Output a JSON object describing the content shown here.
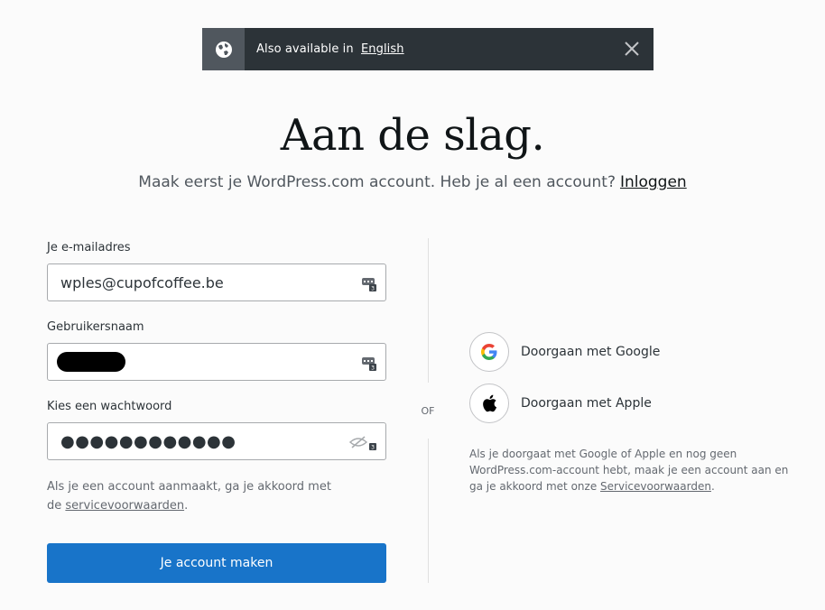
{
  "banner": {
    "text": "Also available in",
    "link": "English"
  },
  "header": {
    "title": "Aan de slag.",
    "subtitle": "Maak eerst je WordPress.com account. Heb je al een account?",
    "login_link": "Inloggen"
  },
  "form": {
    "email_label": "Je e-mailadres",
    "email_value": "wples@cupofcoffee.be",
    "username_label": "Gebruikersnaam",
    "password_label": "Kies een wachtwoord",
    "password_value": "●●●●●●●●●●●●",
    "terms_text": "Als je een account aanmaakt, ga je akkoord met de",
    "terms_link": "servicevoorwaarden",
    "terms_end": ".",
    "submit_label": "Je account maken"
  },
  "divider": {
    "or": "OF"
  },
  "social": {
    "google_label": "Doorgaan met Google",
    "apple_label": "Doorgaan met Apple",
    "note_text": "Als je doorgaat met Google of Apple en nog geen WordPress.com-account hebt, maak je een account aan en ga je akkoord met onze",
    "note_link": "Servicevoorwaarden",
    "note_end": "."
  },
  "colors": {
    "accent": "#1874c9",
    "banner_bg": "#2c3338"
  }
}
